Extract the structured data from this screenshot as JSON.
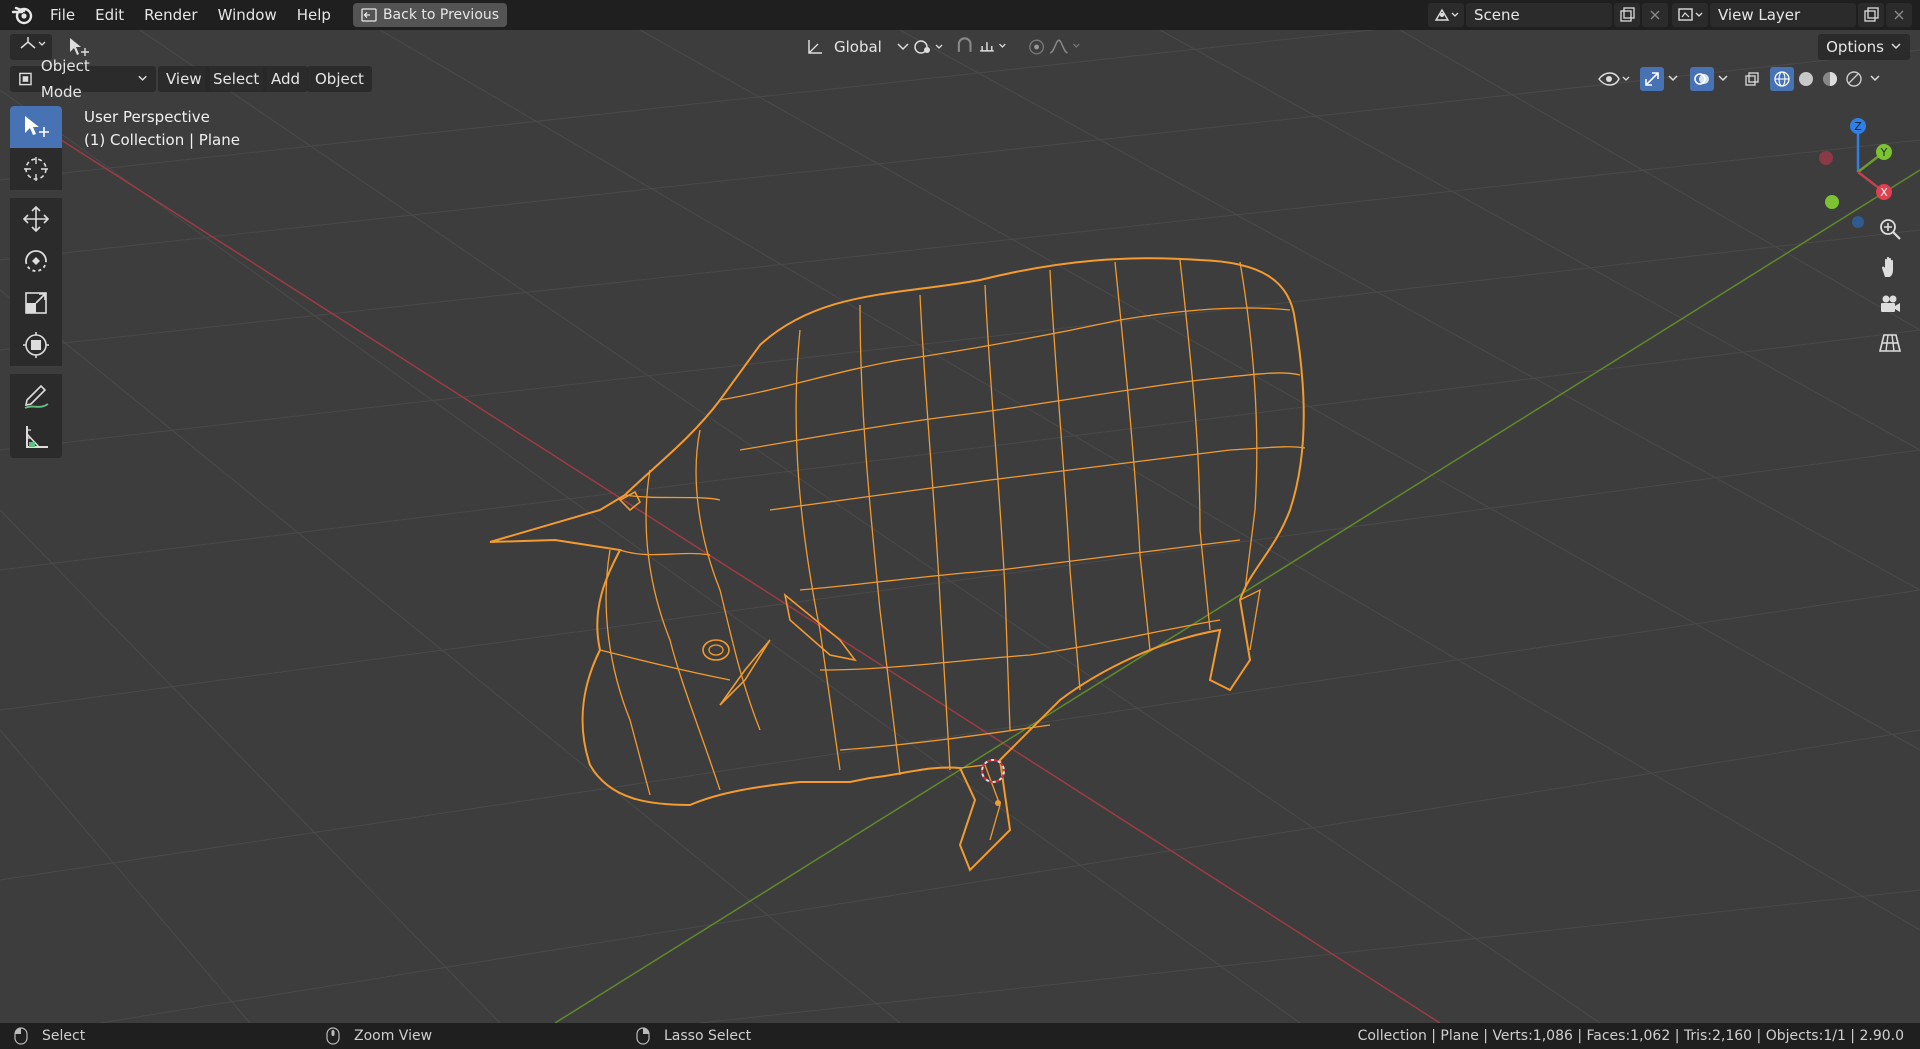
{
  "menu": [
    "File",
    "Edit",
    "Render",
    "Window",
    "Help"
  ],
  "back_button": "Back to Previous",
  "scene": {
    "label": "Scene"
  },
  "view_layer": {
    "label": "View Layer"
  },
  "tool_header": {
    "orientation": "Global",
    "options": "Options"
  },
  "header": {
    "mode": "Object Mode",
    "menus": [
      "View",
      "Select",
      "Add",
      "Object"
    ]
  },
  "viewport_info": {
    "perspective": "User Perspective",
    "collection": "(1) Collection | Plane"
  },
  "gizmo": {
    "z": "Z",
    "y": "Y",
    "x": "X"
  },
  "status": {
    "hints": [
      "Select",
      "Zoom View",
      "Lasso Select"
    ],
    "stats": "Collection | Plane | Verts:1,086 | Faces:1,062 | Tris:2,160 | Objects:1/1 | 2.90.0"
  },
  "colors": {
    "accent": "#4772b3",
    "wireframe": "#f39b2e",
    "x_axis": "#c04050",
    "y_axis": "#6f9a2f",
    "z_axis": "#2f7fe6"
  }
}
